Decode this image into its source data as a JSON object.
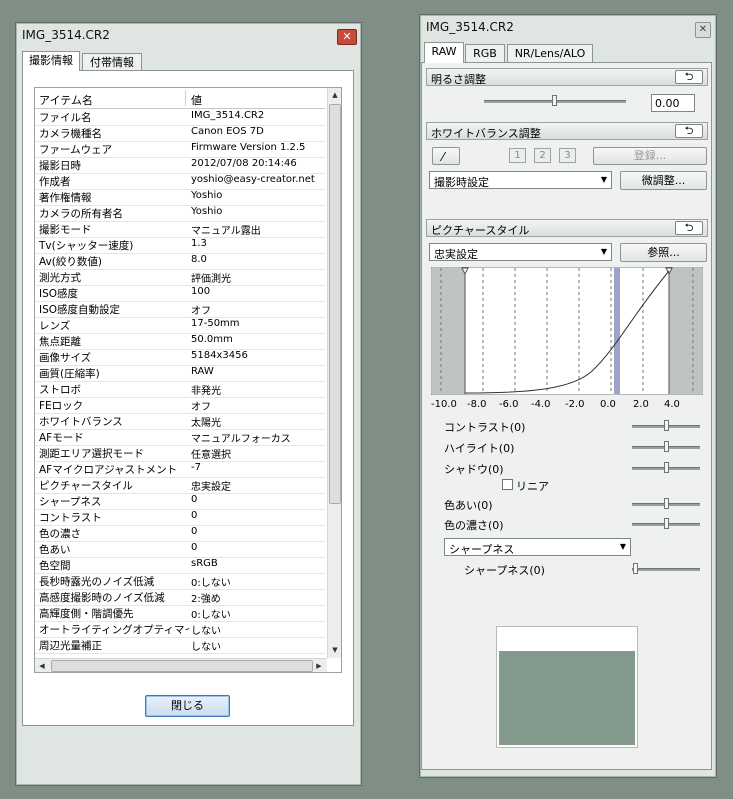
{
  "info_window": {
    "title": "IMG_3514.CR2",
    "tabs": [
      "撮影情報",
      "付帯情報"
    ],
    "columns": [
      "アイテム名",
      "値"
    ],
    "rows": [
      [
        "ファイル名",
        "IMG_3514.CR2"
      ],
      [
        "カメラ機種名",
        "Canon EOS 7D"
      ],
      [
        "ファームウェア",
        "Firmware Version 1.2.5"
      ],
      [
        "撮影日時",
        "2012/07/08 20:14:46"
      ],
      [
        "作成者",
        "yoshio@easy-creator.net"
      ],
      [
        "著作権情報",
        "Yoshio"
      ],
      [
        "カメラの所有者名",
        "Yoshio"
      ],
      [
        "撮影モード",
        "マニュアル露出"
      ],
      [
        "Tv(シャッター速度)",
        "1.3"
      ],
      [
        "Av(絞り数値)",
        "8.0"
      ],
      [
        "測光方式",
        "評価測光"
      ],
      [
        "ISO感度",
        "100"
      ],
      [
        "ISO感度自動設定",
        "オフ"
      ],
      [
        "レンズ",
        "17-50mm"
      ],
      [
        "焦点距離",
        "50.0mm"
      ],
      [
        "画像サイズ",
        "5184x3456"
      ],
      [
        "画質(圧縮率)",
        "RAW"
      ],
      [
        "ストロボ",
        "非発光"
      ],
      [
        "FEロック",
        "オフ"
      ],
      [
        "ホワイトバランス",
        "太陽光"
      ],
      [
        "AFモード",
        "マニュアルフォーカス"
      ],
      [
        "測距エリア選択モード",
        "任意選択"
      ],
      [
        "AFマイクロアジャストメント",
        "-7"
      ],
      [
        "ピクチャースタイル",
        "忠実設定"
      ],
      [
        "シャープネス",
        "0"
      ],
      [
        "コントラスト",
        "0"
      ],
      [
        "色の濃さ",
        "0"
      ],
      [
        "色あい",
        "0"
      ],
      [
        "色空間",
        "sRGB"
      ],
      [
        "長秒時露光のノイズ低減",
        "0:しない"
      ],
      [
        "高感度撮影時のノイズ低減",
        "2:強め"
      ],
      [
        "高輝度側・階調優先",
        "0:しない"
      ],
      [
        "オートライティングオプティマイザ",
        "しない"
      ],
      [
        "周辺光量補正",
        "しない"
      ]
    ],
    "close_button": "閉じる"
  },
  "tool_window": {
    "title": "IMG_3514.CR2",
    "tabs": [
      "RAW",
      "RGB",
      "NR/Lens/ALO"
    ],
    "brightness": {
      "title": "明るさ調整",
      "value": "0.00",
      "reset": "⮌"
    },
    "white_balance": {
      "title": "ホワイトバランス調整",
      "slots": [
        "1",
        "2",
        "3"
      ],
      "register": "登録...",
      "preset": "撮影時設定",
      "fine_tune": "微調整...",
      "reset": "⮌"
    },
    "picture_style": {
      "title": "ピクチャースタイル",
      "preset": "忠実設定",
      "browse": "参照...",
      "reset": "⮌",
      "axis_labels": [
        "-10.0",
        "-8.0",
        "-6.0",
        "-4.0",
        "-2.0",
        "0.0",
        "2.0",
        "4.0"
      ],
      "contrast": "コントラスト(0)",
      "highlight": "ハイライト(0)",
      "shadow": "シャドウ(0)",
      "linear": "リニア",
      "hue": "色あい(0)",
      "saturation": "色の濃さ(0)",
      "sharp_select": "シャープネス",
      "sharpness": "シャープネス(0)"
    }
  },
  "colors": {
    "preview": "#83998c",
    "accent_blue": "#3b78b8"
  }
}
